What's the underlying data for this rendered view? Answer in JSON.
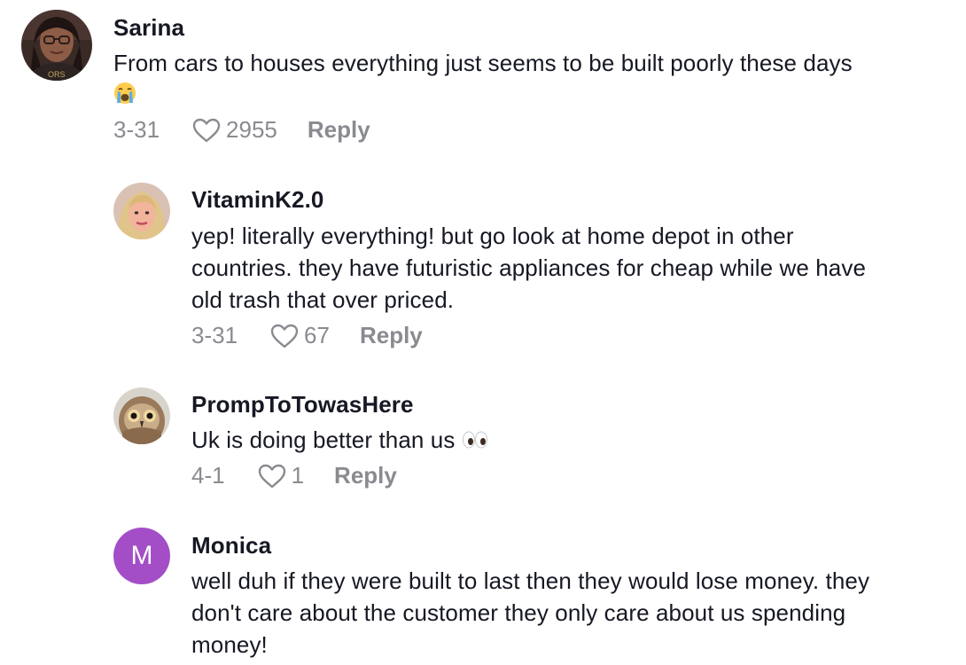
{
  "comments": [
    {
      "username": "Sarina",
      "text": "From cars to houses everything just seems to be built poorly these days",
      "emoji": "loudly-crying-face-emoji",
      "date": "3-31",
      "likes": "2955",
      "reply_label": "Reply",
      "avatar": "photo-avatar-woman-glasses"
    },
    {
      "username": "VitaminK2.0",
      "text": "yep! literally everything! but go look at home depot in other countries. they have futuristic appliances for cheap while we have old trash that over priced.",
      "date": "3-31",
      "likes": "67",
      "reply_label": "Reply",
      "avatar": "photo-avatar-woman-blonde"
    },
    {
      "username": "PrompToTowasHere",
      "text": "Uk is doing better than us",
      "emoji": "eyes-emoji",
      "date": "4-1",
      "likes": "1",
      "reply_label": "Reply",
      "avatar": "photo-avatar-owl"
    },
    {
      "username": "Monica",
      "text": "well duh if they were built to last then they would lose money. they don't care about the customer they only care about us spending money!",
      "avatar_letter": "M",
      "avatar_color": "#a34ec6"
    }
  ],
  "colors": {
    "text": "#161823",
    "meta": "#8a8b91"
  },
  "icons": {
    "like": "heart-outline-icon"
  }
}
